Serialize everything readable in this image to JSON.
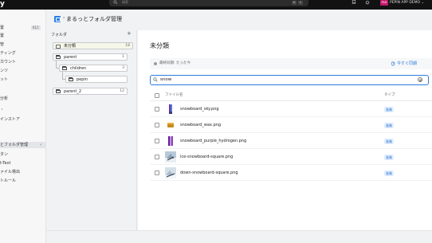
{
  "topbar": {
    "logo_text": "y",
    "search_placeholder": "検索",
    "kbd1": "⌘",
    "kbd2": "K",
    "avatar_text": "PAD",
    "user_name": "PEPIN APP DEMO",
    "user_chevron": "⌄"
  },
  "sidebar": {
    "items": [
      {
        "label": "置",
        "badge": "612"
      },
      {
        "label": "置"
      },
      {
        "label": "管"
      },
      {
        "label": "ティング"
      },
      {
        "label": "カウント"
      },
      {
        "label": "ンツ"
      },
      {
        "label": "ット"
      },
      {
        "label": "分析"
      },
      {
        "label": "・"
      },
      {
        "label": "インストア"
      },
      {
        "label": "とフォルダ管理",
        "chevron": "‹"
      },
      {
        "label": "タン"
      },
      {
        "label": "t-Text"
      },
      {
        "label": "ァイル検出"
      },
      {
        "label": "トルール"
      }
    ]
  },
  "header": {
    "breadcrumb_sep": "›",
    "title": "まるっとフォルダ管理"
  },
  "folders": {
    "title": "フォルダ",
    "add": "+",
    "items": [
      {
        "label": "未分類",
        "count": "18"
      },
      {
        "label": "parent",
        "count": "1"
      },
      {
        "label": "children",
        "count": "3"
      },
      {
        "label": "pepin",
        "count": ""
      },
      {
        "label": "parent_2",
        "count": "12"
      }
    ]
  },
  "main": {
    "title": "未分類",
    "sync_text": "最終同期: たった今",
    "sync_button": "今すぐ同期",
    "search_value": "snow",
    "col_name": "ファイル名",
    "col_type": "タイプ",
    "rows": [
      {
        "name": "snowboard_sky.png",
        "type": "画像"
      },
      {
        "name": "snowboard_wax.png",
        "type": "画像"
      },
      {
        "name": "snowboard_purple_hydrogen.png",
        "type": "画像"
      },
      {
        "name": "ice-snowboard-square.png",
        "type": "画像"
      },
      {
        "name": "down-snowboard-square.png",
        "type": "画像"
      }
    ]
  },
  "colors": {
    "accent": "#2a7de1",
    "topbar_bg": "#121212",
    "avatar_bg": "#c2186b",
    "badge_bg": "#e2efff"
  }
}
